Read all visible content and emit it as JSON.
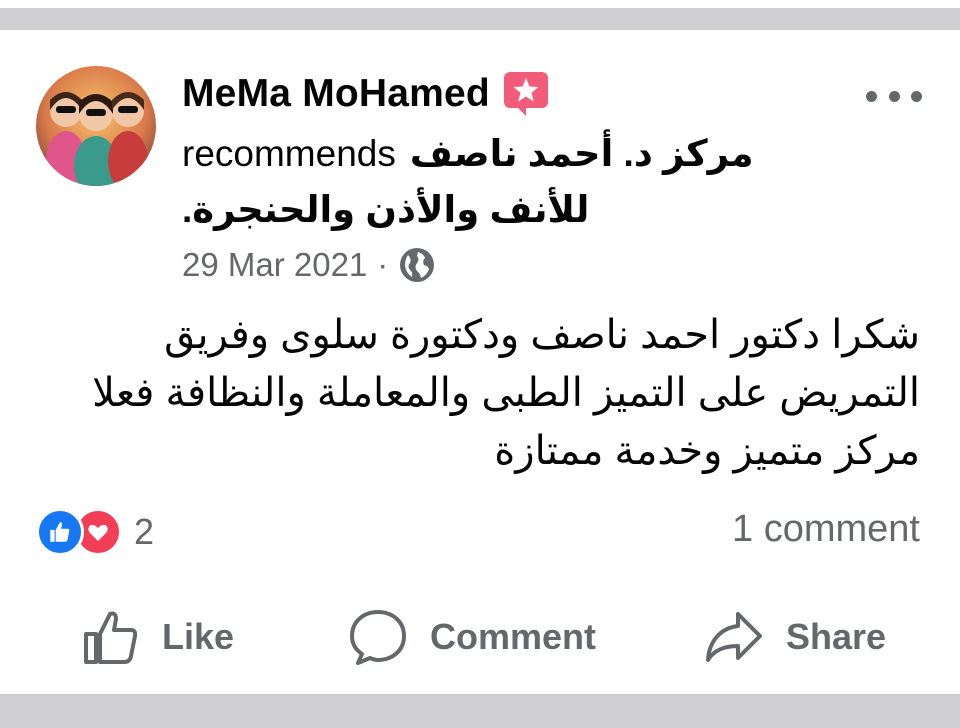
{
  "post": {
    "author_name": "MeMa MoHamed",
    "recommend_word": "recommends",
    "page_name_line1": "مركز د. أحمد ناصف",
    "page_name_line2": "للأنف والأذن والحنجرة.",
    "date": "29 Mar 2021",
    "separator": "·",
    "privacy_icon": "globe-icon",
    "body_lines": [
      "شكرا دكتور احمد ناصف ودكتورة سلوى وفريق",
      "التمريض على التميز الطبى والمعاملة والنظافة فعلا",
      "مركز متميز وخدمة ممتازة"
    ]
  },
  "reactions": {
    "icons": [
      "like-reaction-icon",
      "love-reaction-icon"
    ],
    "count": "2",
    "comments_label": "1 comment"
  },
  "actions": {
    "like_label": "Like",
    "comment_label": "Comment",
    "share_label": "Share"
  },
  "colors": {
    "like_blue": "#1877f2",
    "love_red": "#f33e58",
    "badge_pink": "#f25b7a",
    "secondary_text": "#65676b",
    "divider_gray": "#cfcfd1"
  }
}
